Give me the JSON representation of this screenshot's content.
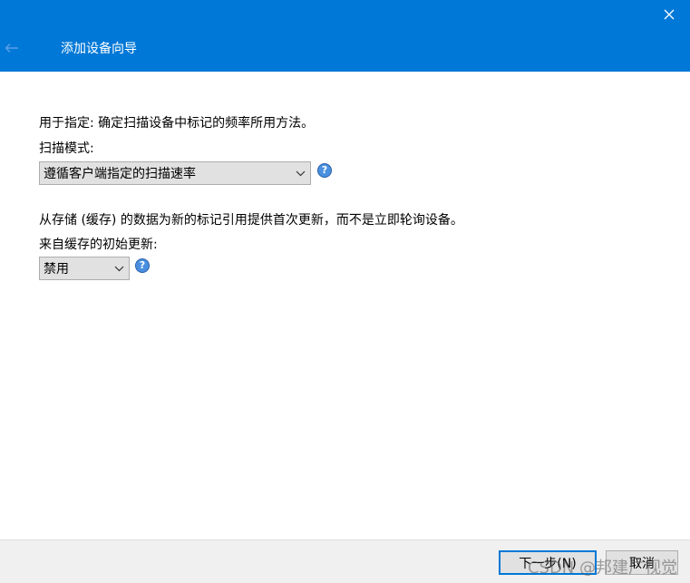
{
  "window": {
    "title": "添加设备向导"
  },
  "colors": {
    "titlebar": "#0078d7",
    "help_icon": "#4a8fe0",
    "footer": "#f0f0f0"
  },
  "icons": {
    "back": "arrow-left-icon",
    "close": "close-icon",
    "help": "help-icon",
    "dropdown": "chevron-down-icon"
  },
  "scan": {
    "description": "用于指定: 确定扫描设备中标记的频率所用方法。",
    "label": "扫描模式:",
    "selected": "遵循客户端指定的扫描速率",
    "help_glyph": "?"
  },
  "cache": {
    "description": "从存储 (缓存) 的数据为新的标记引用提供首次更新，而不是立即轮询设备。",
    "label": "来自缓存的初始更新:",
    "selected": "禁用",
    "help_glyph": "?"
  },
  "footer": {
    "next_label": "下一步(N)",
    "cancel_label": "取消"
  },
  "watermark": "CSDN @邦建广视觉"
}
